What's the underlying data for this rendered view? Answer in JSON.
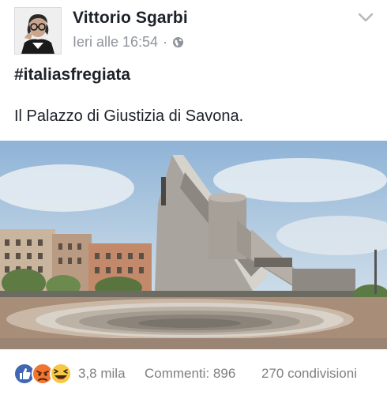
{
  "post": {
    "author": "Vittorio Sgarbi",
    "timestamp": "Ieri alle 16:54",
    "separator": "·",
    "audience_icon": "globe-icon",
    "menu_icon": "chevron-down-icon",
    "hashtag": "#italiasfregiata",
    "text": "Il Palazzo di Giustizia di Savona."
  },
  "reactions": {
    "icons": [
      "like-icon",
      "angry-icon",
      "haha-icon"
    ],
    "count": "3,8 mila",
    "comments": "Commenti: 896",
    "shares": "270 condivisioni"
  },
  "colors": {
    "like_blue": "#4267b2",
    "angry_orange": "#f0762f",
    "haha_yellow": "#f7c745",
    "meta_gray": "#90949c"
  }
}
